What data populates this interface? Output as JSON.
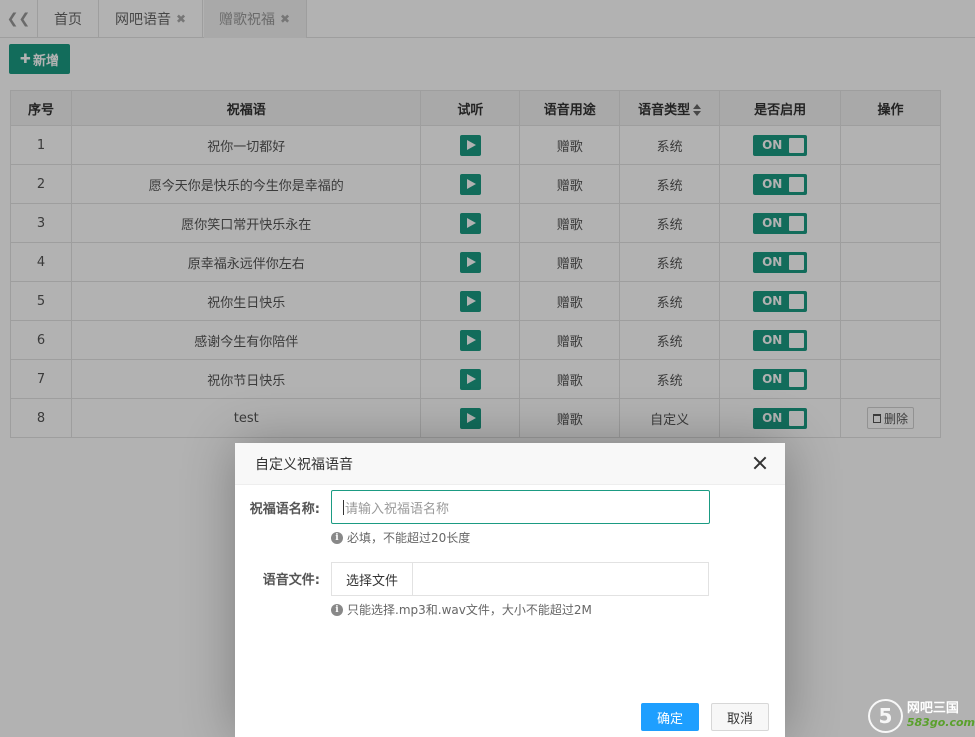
{
  "tabs": [
    {
      "label": "首页",
      "closable": false
    },
    {
      "label": "网吧语音",
      "closable": true
    },
    {
      "label": "赠歌祝福",
      "closable": true,
      "active": true
    }
  ],
  "toolbar": {
    "add_label": "新增"
  },
  "table": {
    "headers": [
      "序号",
      "祝福语",
      "试听",
      "语音用途",
      "语音类型",
      "是否启用",
      "操作"
    ],
    "rows": [
      {
        "no": "1",
        "text": "祝你一切都好",
        "use": "赠歌",
        "type": "系统",
        "enabled": "ON",
        "action": ""
      },
      {
        "no": "2",
        "text": "愿今天你是快乐的今生你是幸福的",
        "use": "赠歌",
        "type": "系统",
        "enabled": "ON",
        "action": ""
      },
      {
        "no": "3",
        "text": "愿你笑口常开快乐永在",
        "use": "赠歌",
        "type": "系统",
        "enabled": "ON",
        "action": ""
      },
      {
        "no": "4",
        "text": "原幸福永远伴你左右",
        "use": "赠歌",
        "type": "系统",
        "enabled": "ON",
        "action": ""
      },
      {
        "no": "5",
        "text": "祝你生日快乐",
        "use": "赠歌",
        "type": "系统",
        "enabled": "ON",
        "action": ""
      },
      {
        "no": "6",
        "text": "感谢今生有你陪伴",
        "use": "赠歌",
        "type": "系统",
        "enabled": "ON",
        "action": ""
      },
      {
        "no": "7",
        "text": "祝你节日快乐",
        "use": "赠歌",
        "type": "系统",
        "enabled": "ON",
        "action": ""
      },
      {
        "no": "8",
        "text": "test",
        "use": "赠歌",
        "type": "自定义",
        "enabled": "ON",
        "action": "删除"
      }
    ]
  },
  "dialog": {
    "title": "自定义祝福语音",
    "name_label": "祝福语名称:",
    "name_placeholder": "请输入祝福语名称",
    "name_hint": "必填，不能超过20长度",
    "file_label": "语音文件:",
    "file_button": "选择文件",
    "file_value": "",
    "file_hint": "只能选择.mp3和.wav文件，大小不能超过2M",
    "ok_label": "确定",
    "cancel_label": "取消"
  },
  "watermark": {
    "title": "网吧三国",
    "url": "583go.com",
    "logo": "5"
  },
  "colors": {
    "accent": "#1b9b83",
    "primary_button": "#1e9fff"
  }
}
